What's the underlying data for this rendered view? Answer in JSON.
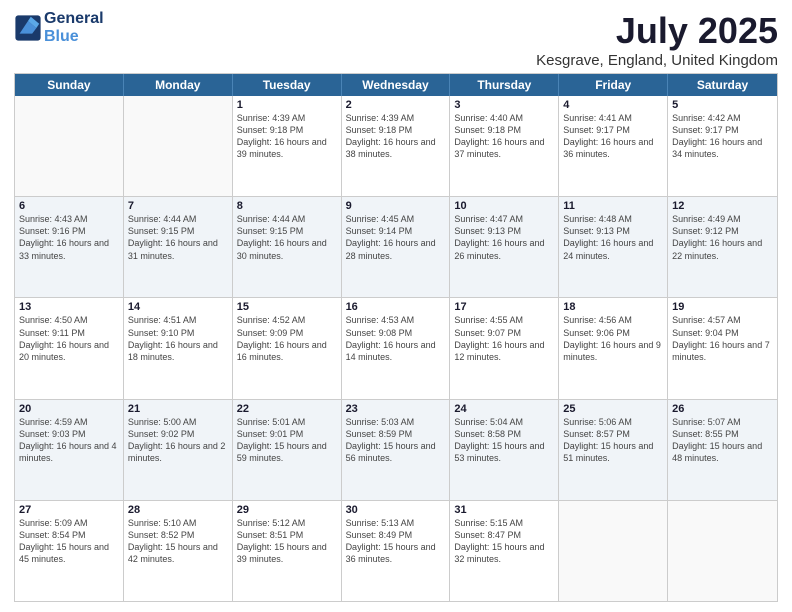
{
  "header": {
    "logo_line1": "General",
    "logo_line2": "Blue",
    "main_title": "July 2025",
    "subtitle": "Kesgrave, England, United Kingdom"
  },
  "days_of_week": [
    "Sunday",
    "Monday",
    "Tuesday",
    "Wednesday",
    "Thursday",
    "Friday",
    "Saturday"
  ],
  "weeks": [
    [
      {
        "num": "",
        "info": ""
      },
      {
        "num": "",
        "info": ""
      },
      {
        "num": "1",
        "info": "Sunrise: 4:39 AM\nSunset: 9:18 PM\nDaylight: 16 hours and 39 minutes."
      },
      {
        "num": "2",
        "info": "Sunrise: 4:39 AM\nSunset: 9:18 PM\nDaylight: 16 hours and 38 minutes."
      },
      {
        "num": "3",
        "info": "Sunrise: 4:40 AM\nSunset: 9:18 PM\nDaylight: 16 hours and 37 minutes."
      },
      {
        "num": "4",
        "info": "Sunrise: 4:41 AM\nSunset: 9:17 PM\nDaylight: 16 hours and 36 minutes."
      },
      {
        "num": "5",
        "info": "Sunrise: 4:42 AM\nSunset: 9:17 PM\nDaylight: 16 hours and 34 minutes."
      }
    ],
    [
      {
        "num": "6",
        "info": "Sunrise: 4:43 AM\nSunset: 9:16 PM\nDaylight: 16 hours and 33 minutes."
      },
      {
        "num": "7",
        "info": "Sunrise: 4:44 AM\nSunset: 9:15 PM\nDaylight: 16 hours and 31 minutes."
      },
      {
        "num": "8",
        "info": "Sunrise: 4:44 AM\nSunset: 9:15 PM\nDaylight: 16 hours and 30 minutes."
      },
      {
        "num": "9",
        "info": "Sunrise: 4:45 AM\nSunset: 9:14 PM\nDaylight: 16 hours and 28 minutes."
      },
      {
        "num": "10",
        "info": "Sunrise: 4:47 AM\nSunset: 9:13 PM\nDaylight: 16 hours and 26 minutes."
      },
      {
        "num": "11",
        "info": "Sunrise: 4:48 AM\nSunset: 9:13 PM\nDaylight: 16 hours and 24 minutes."
      },
      {
        "num": "12",
        "info": "Sunrise: 4:49 AM\nSunset: 9:12 PM\nDaylight: 16 hours and 22 minutes."
      }
    ],
    [
      {
        "num": "13",
        "info": "Sunrise: 4:50 AM\nSunset: 9:11 PM\nDaylight: 16 hours and 20 minutes."
      },
      {
        "num": "14",
        "info": "Sunrise: 4:51 AM\nSunset: 9:10 PM\nDaylight: 16 hours and 18 minutes."
      },
      {
        "num": "15",
        "info": "Sunrise: 4:52 AM\nSunset: 9:09 PM\nDaylight: 16 hours and 16 minutes."
      },
      {
        "num": "16",
        "info": "Sunrise: 4:53 AM\nSunset: 9:08 PM\nDaylight: 16 hours and 14 minutes."
      },
      {
        "num": "17",
        "info": "Sunrise: 4:55 AM\nSunset: 9:07 PM\nDaylight: 16 hours and 12 minutes."
      },
      {
        "num": "18",
        "info": "Sunrise: 4:56 AM\nSunset: 9:06 PM\nDaylight: 16 hours and 9 minutes."
      },
      {
        "num": "19",
        "info": "Sunrise: 4:57 AM\nSunset: 9:04 PM\nDaylight: 16 hours and 7 minutes."
      }
    ],
    [
      {
        "num": "20",
        "info": "Sunrise: 4:59 AM\nSunset: 9:03 PM\nDaylight: 16 hours and 4 minutes."
      },
      {
        "num": "21",
        "info": "Sunrise: 5:00 AM\nSunset: 9:02 PM\nDaylight: 16 hours and 2 minutes."
      },
      {
        "num": "22",
        "info": "Sunrise: 5:01 AM\nSunset: 9:01 PM\nDaylight: 15 hours and 59 minutes."
      },
      {
        "num": "23",
        "info": "Sunrise: 5:03 AM\nSunset: 8:59 PM\nDaylight: 15 hours and 56 minutes."
      },
      {
        "num": "24",
        "info": "Sunrise: 5:04 AM\nSunset: 8:58 PM\nDaylight: 15 hours and 53 minutes."
      },
      {
        "num": "25",
        "info": "Sunrise: 5:06 AM\nSunset: 8:57 PM\nDaylight: 15 hours and 51 minutes."
      },
      {
        "num": "26",
        "info": "Sunrise: 5:07 AM\nSunset: 8:55 PM\nDaylight: 15 hours and 48 minutes."
      }
    ],
    [
      {
        "num": "27",
        "info": "Sunrise: 5:09 AM\nSunset: 8:54 PM\nDaylight: 15 hours and 45 minutes."
      },
      {
        "num": "28",
        "info": "Sunrise: 5:10 AM\nSunset: 8:52 PM\nDaylight: 15 hours and 42 minutes."
      },
      {
        "num": "29",
        "info": "Sunrise: 5:12 AM\nSunset: 8:51 PM\nDaylight: 15 hours and 39 minutes."
      },
      {
        "num": "30",
        "info": "Sunrise: 5:13 AM\nSunset: 8:49 PM\nDaylight: 15 hours and 36 minutes."
      },
      {
        "num": "31",
        "info": "Sunrise: 5:15 AM\nSunset: 8:47 PM\nDaylight: 15 hours and 32 minutes."
      },
      {
        "num": "",
        "info": ""
      },
      {
        "num": "",
        "info": ""
      }
    ]
  ]
}
